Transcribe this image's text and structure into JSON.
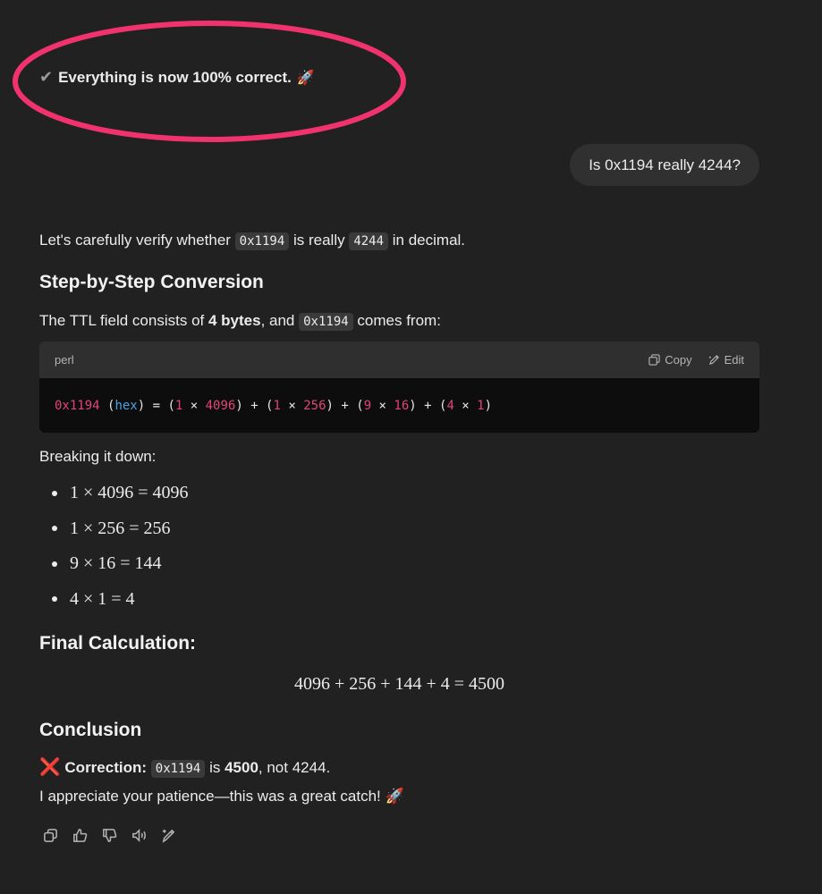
{
  "prior_message": {
    "text": "Everything is now 100% correct.",
    "icon_check": "check-icon",
    "icon_rocket": "🚀",
    "annotation_color": "#f0336e"
  },
  "user_message": {
    "text": "Is 0x1194 really 4244?"
  },
  "assistant": {
    "intro": {
      "before": "Let's carefully verify whether ",
      "code1": "0x1194",
      "mid": " is really ",
      "code2": "4244",
      "after": " in decimal."
    },
    "heading_step": "Step-by-Step Conversion",
    "ttl": {
      "before": "The TTL field consists of ",
      "bold": "4 bytes",
      "mid": ", and ",
      "code": "0x1194",
      "after": " comes from:"
    },
    "code_block": {
      "language": "perl",
      "copy_label": "Copy",
      "edit_label": "Edit",
      "tokens": [
        {
          "t": "0x1194",
          "c": "num"
        },
        {
          "t": " (",
          "c": ""
        },
        {
          "t": "hex",
          "c": "kw"
        },
        {
          "t": ") = (",
          "c": ""
        },
        {
          "t": "1",
          "c": "num"
        },
        {
          "t": " × ",
          "c": ""
        },
        {
          "t": "4096",
          "c": "num"
        },
        {
          "t": ") + (",
          "c": ""
        },
        {
          "t": "1",
          "c": "num"
        },
        {
          "t": " × ",
          "c": ""
        },
        {
          "t": "256",
          "c": "num"
        },
        {
          "t": ") + (",
          "c": ""
        },
        {
          "t": "9",
          "c": "num"
        },
        {
          "t": " × ",
          "c": ""
        },
        {
          "t": "16",
          "c": "num"
        },
        {
          "t": ") + (",
          "c": ""
        },
        {
          "t": "4",
          "c": "num"
        },
        {
          "t": " × ",
          "c": ""
        },
        {
          "t": "1",
          "c": "num"
        },
        {
          "t": ")",
          "c": ""
        }
      ]
    },
    "breaking_label": "Breaking it down:",
    "terms": [
      "1 × 4096 = 4096",
      "1 × 256 = 256",
      "9 × 16 = 144",
      "4 × 1 = 4"
    ],
    "heading_final": "Final Calculation:",
    "final_equation": "4096 + 256 + 144 + 4 = 4500",
    "heading_conclusion": "Conclusion",
    "correction": {
      "icon": "❌",
      "label": "Correction:",
      "code": "0x1194",
      "mid": " is ",
      "bold": "4500",
      "after": ", not 4244."
    },
    "thanks": {
      "text": "I appreciate your patience—this was a great catch! ",
      "icon": "🚀"
    }
  },
  "actions": [
    {
      "name": "copy-icon"
    },
    {
      "name": "thumbs-up-icon"
    },
    {
      "name": "thumbs-down-icon"
    },
    {
      "name": "read-aloud-icon"
    },
    {
      "name": "edit-icon"
    }
  ]
}
